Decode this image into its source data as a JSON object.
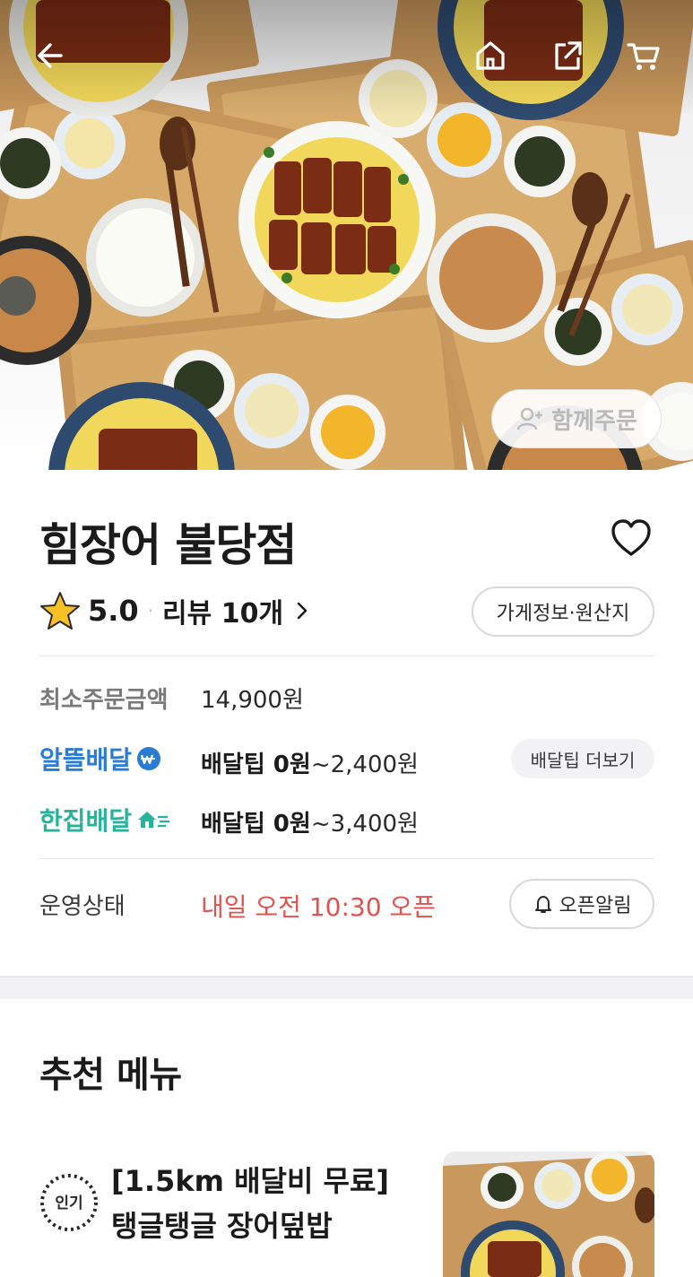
{
  "header": {
    "back_icon": "back-arrow-icon",
    "home_icon": "home-icon",
    "share_icon": "share-icon",
    "cart_icon": "cart-icon",
    "group_order_label": "함께주문"
  },
  "store": {
    "name": "힘장어 불당점",
    "rating": "5.0",
    "reviews": "리뷰 10개",
    "info_button": "가게정보·원산지"
  },
  "delivery": {
    "min_order_label": "최소주문금액",
    "min_order_value": "14,900원",
    "options": [
      {
        "name": "알뜰배달",
        "tip_bold": "배달팁 0원",
        "tip_rest": "~2,400원",
        "color": "#2a7bd6"
      },
      {
        "name": "한집배달",
        "tip_bold": "배달팁 0원",
        "tip_rest": "~3,400원",
        "color": "#26b39b"
      }
    ],
    "more_tips_button": "배달팁 더보기"
  },
  "status": {
    "label": "운영상태",
    "value": "내일 오전 10:30 오픈",
    "notify_button": "오픈알림"
  },
  "recommended": {
    "title": "추천 메뉴",
    "items": [
      {
        "badge": "인기",
        "name_line1": "[1.5km 배달비 무료]",
        "name_line2": "탱글탱글 장어덮밥"
      }
    ]
  },
  "colors": {
    "accent_red": "#e0524f",
    "alddeul_blue": "#2a7bd6",
    "hanjip_teal": "#26b39b"
  }
}
